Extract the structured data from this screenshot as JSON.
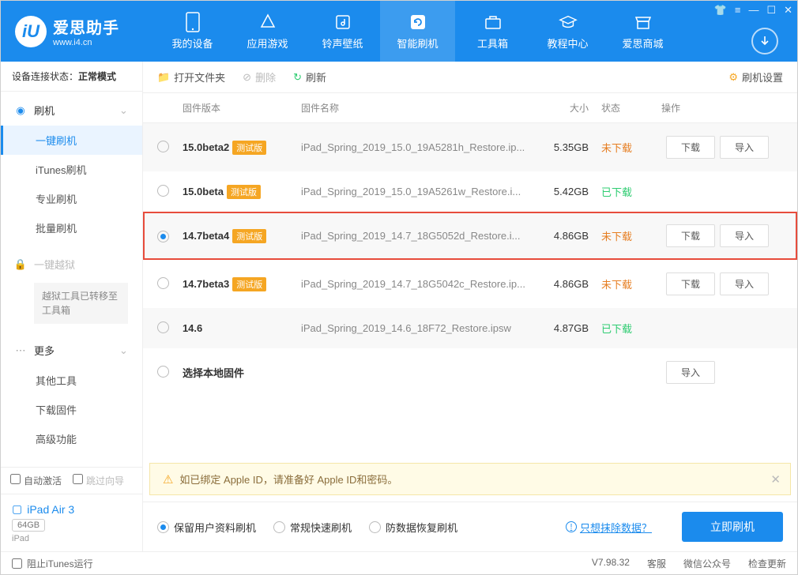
{
  "app": {
    "name": "爱思助手",
    "url": "www.i4.cn"
  },
  "nav": [
    {
      "label": "我的设备"
    },
    {
      "label": "应用游戏"
    },
    {
      "label": "铃声壁纸"
    },
    {
      "label": "智能刷机"
    },
    {
      "label": "工具箱"
    },
    {
      "label": "教程中心"
    },
    {
      "label": "爱思商城"
    }
  ],
  "conn_status_label": "设备连接状态：",
  "conn_status_value": "正常模式",
  "sidebar": {
    "flash_head": "刷机",
    "items": [
      "一键刷机",
      "iTunes刷机",
      "专业刷机",
      "批量刷机"
    ],
    "jailbreak_head": "一键越狱",
    "jailbreak_note": "越狱工具已转移至工具箱",
    "more_head": "更多",
    "more_items": [
      "其他工具",
      "下载固件",
      "高级功能"
    ]
  },
  "auto_activate": "自动激活",
  "skip_guide": "跳过向导",
  "device": {
    "name": "iPad Air 3",
    "storage": "64GB",
    "type": "iPad"
  },
  "toolbar": {
    "open": "打开文件夹",
    "delete": "删除",
    "refresh": "刷新",
    "settings": "刷机设置"
  },
  "columns": {
    "ver": "固件版本",
    "name": "固件名称",
    "size": "大小",
    "status": "状态",
    "act": "操作"
  },
  "rows": [
    {
      "ver": "15.0beta2",
      "beta": "测试版",
      "name": "iPad_Spring_2019_15.0_19A5281h_Restore.ip...",
      "size": "5.35GB",
      "status": "未下载",
      "st": "not",
      "dl": true,
      "imp": true
    },
    {
      "ver": "15.0beta",
      "beta": "测试版",
      "name": "iPad_Spring_2019_15.0_19A5261w_Restore.i...",
      "size": "5.42GB",
      "status": "已下载",
      "st": "done",
      "dl": false,
      "imp": false
    },
    {
      "ver": "14.7beta4",
      "beta": "测试版",
      "name": "iPad_Spring_2019_14.7_18G5052d_Restore.i...",
      "size": "4.86GB",
      "status": "未下载",
      "st": "not",
      "dl": true,
      "imp": true,
      "selected": true,
      "highlight": true
    },
    {
      "ver": "14.7beta3",
      "beta": "测试版",
      "name": "iPad_Spring_2019_14.7_18G5042c_Restore.ip...",
      "size": "4.86GB",
      "status": "未下载",
      "st": "not",
      "dl": true,
      "imp": true
    },
    {
      "ver": "14.6",
      "beta": "",
      "name": "iPad_Spring_2019_14.6_18F72_Restore.ipsw",
      "size": "4.87GB",
      "status": "已下载",
      "st": "done",
      "dl": false,
      "imp": false
    },
    {
      "ver": "选择本地固件",
      "beta": "",
      "name": "",
      "size": "",
      "status": "",
      "st": "",
      "dl": false,
      "imp": true
    }
  ],
  "btn_download": "下载",
  "btn_import": "导入",
  "warn": "如已绑定 Apple ID，请准备好 Apple ID和密码。",
  "flash_opts": [
    "保留用户资料刷机",
    "常规快速刷机",
    "防数据恢复刷机"
  ],
  "erase_link": "只想抹除数据？",
  "flash_now": "立即刷机",
  "footer": {
    "block_itunes": "阻止iTunes运行",
    "version": "V7.98.32",
    "service": "客服",
    "wechat": "微信公众号",
    "update": "检查更新"
  }
}
